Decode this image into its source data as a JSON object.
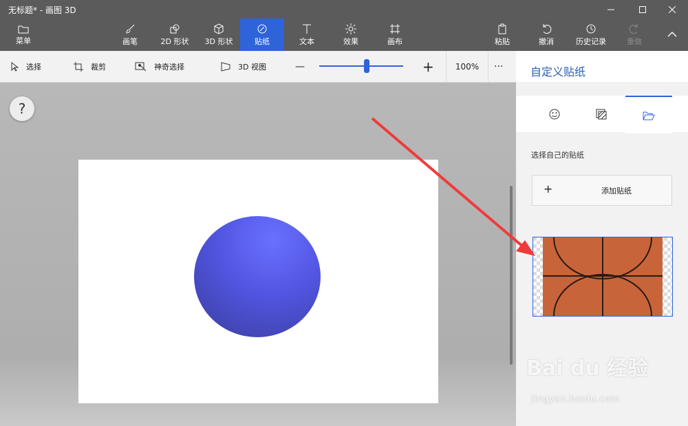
{
  "window": {
    "title": "无标题* - 画图 3D"
  },
  "ribbon": {
    "menu": "菜单",
    "brushes": "画笔",
    "shapes2d": "2D 形状",
    "shapes3d": "3D 形状",
    "stickers": "贴纸",
    "text": "文本",
    "effects": "效果",
    "canvas": "画布",
    "paste": "粘贴",
    "undo": "撤消",
    "history": "历史记录",
    "redo": "重做"
  },
  "toolbar": {
    "select": "选择",
    "crop": "裁剪",
    "magic_select": "神奇选择",
    "view3d": "3D 视图",
    "zoom_minus": "—",
    "zoom_plus": "+",
    "zoom_level": "100%",
    "zoom_fraction": 0.52,
    "more": "···"
  },
  "help": "?",
  "panel": {
    "title": "自定义贴纸",
    "section_label": "选择自己的贴纸",
    "add_plus": "+",
    "add_label": "添加贴纸"
  },
  "watermark": {
    "brand": "Bai du 经验",
    "url": "jingyan.baidu.com"
  },
  "colors": {
    "accent": "#2e63d9",
    "ribbon_bg": "#5b5b5b",
    "sphere": "#5055e0",
    "basketball": "#c8643a"
  }
}
